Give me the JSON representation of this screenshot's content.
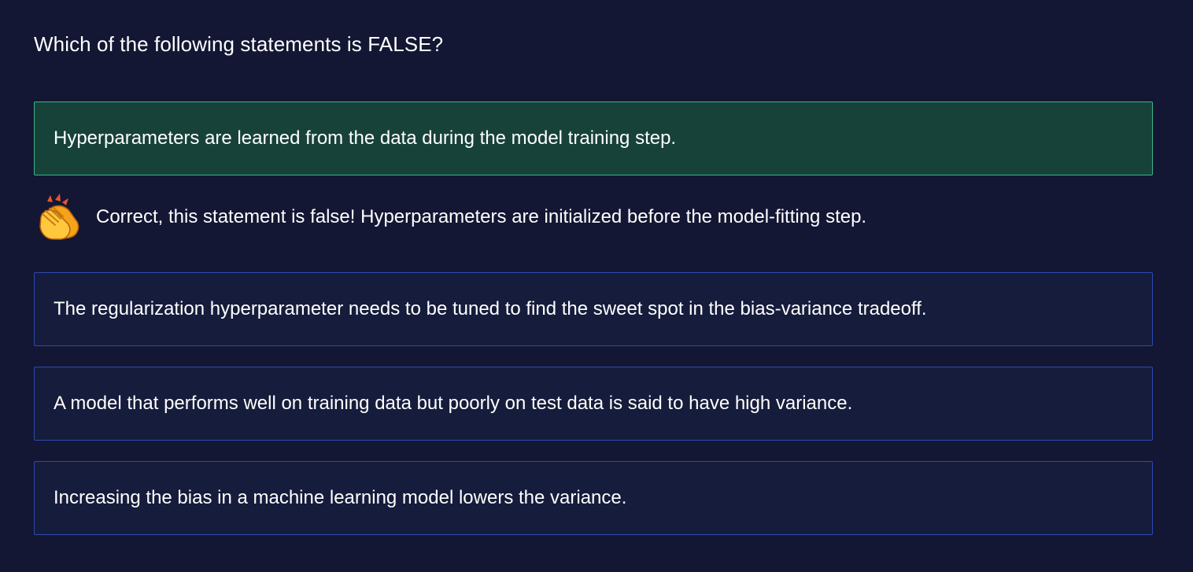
{
  "question": {
    "text": "Which of the following statements is FALSE?"
  },
  "options": [
    {
      "label": "Hyperparameters are learned from the data during the model training step.",
      "state": "correct"
    },
    {
      "label": "The regularization hyperparameter needs to be tuned to find the sweet spot in the bias-variance tradeoff.",
      "state": "default"
    },
    {
      "label": "A model that performs well on training data but poorly on test data is said to have high variance.",
      "state": "default"
    },
    {
      "label": "Increasing the bias in a machine learning model lowers the variance.",
      "state": "default"
    }
  ],
  "feedback": {
    "icon": "clapping-hands-icon",
    "text": "Correct, this statement is false! Hyperparameters are initialized before the model-fitting step."
  },
  "colors": {
    "background": "#131733",
    "option_background": "#161c3b",
    "option_border": "#2c4ab3",
    "correct_background": "#17423a",
    "correct_border": "#3fb38a",
    "text": "#ffffff"
  }
}
